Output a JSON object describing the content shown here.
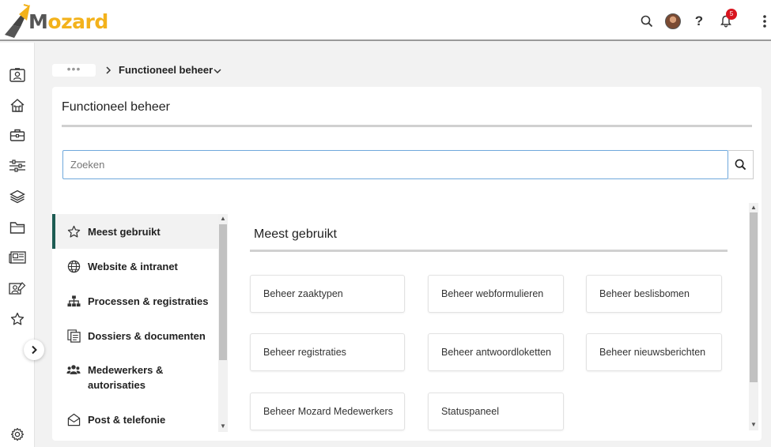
{
  "app": {
    "brand_prefix": "M",
    "brand_rest": "ozard"
  },
  "header": {
    "help_label": "?",
    "notification_count": "5"
  },
  "breadcrumb": {
    "ellipsis": "•••",
    "current": "Functioneel beheer"
  },
  "page": {
    "title": "Functioneel beheer",
    "search_placeholder": "Zoeken"
  },
  "categories": [
    {
      "label": "Meest gebruikt",
      "icon": "star-icon",
      "active": true
    },
    {
      "label": "Website & intranet",
      "icon": "globe-icon"
    },
    {
      "label": "Processen & registraties",
      "icon": "sitemap-icon"
    },
    {
      "label": "Dossiers & documenten",
      "icon": "documents-icon"
    },
    {
      "label": "Medewerkers & autorisaties",
      "icon": "users-icon"
    },
    {
      "label": "Post & telefonie",
      "icon": "envelope-open-icon"
    }
  ],
  "section": {
    "title": "Meest gebruikt"
  },
  "tiles": [
    "Beheer zaaktypen",
    "Beheer webformulieren",
    "Beheer beslisbomen",
    "Beheer registraties",
    "Beheer antwoordloketten",
    "Beheer nieuwsberichten",
    "Beheer Mozard Medewerkers",
    "Statuspaneel"
  ],
  "colors": {
    "brand_yellow": "#f3b21b",
    "active_accent": "#1d5c53",
    "notification_red": "#d9141e",
    "search_focus": "#6fa8dc"
  }
}
